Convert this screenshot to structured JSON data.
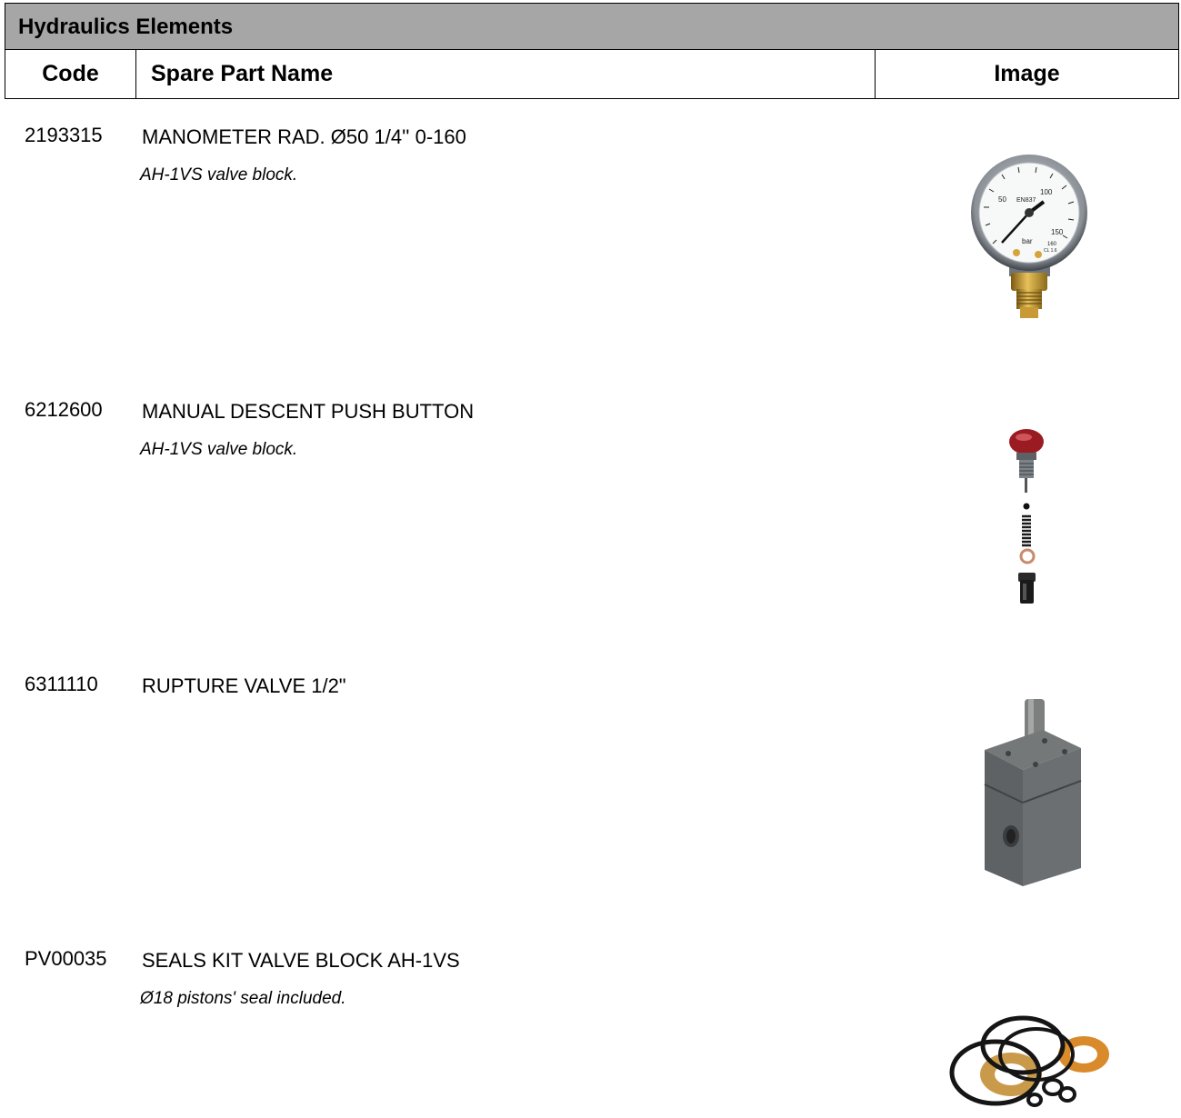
{
  "section": {
    "title": "Hydraulics Elements"
  },
  "columns": {
    "code": "Code",
    "name": "Spare Part Name",
    "image": "Image"
  },
  "parts": [
    {
      "code": "2193315",
      "name": "MANOMETER RAD. Ø50 1/4'' 0-160",
      "note": "AH-1VS valve block.",
      "image": "pressure-gauge"
    },
    {
      "code": "6212600",
      "name": "MANUAL DESCENT PUSH BUTTON",
      "note": "AH-1VS valve block.",
      "image": "push-button-assembly"
    },
    {
      "code": "6311110",
      "name": "RUPTURE VALVE 1/2\"",
      "note": "",
      "image": "rupture-valve-block"
    },
    {
      "code": "PV00035",
      "name": "SEALS KIT VALVE BLOCK AH-1VS",
      "note": "Ø18 pistons' seal included.",
      "image": "seal-kit-rings"
    }
  ],
  "gauge": {
    "ticks": [
      "50",
      "100",
      "150"
    ],
    "brand": "EN837",
    "unit": "bar",
    "max": "160",
    "class": "CL 1.6"
  }
}
